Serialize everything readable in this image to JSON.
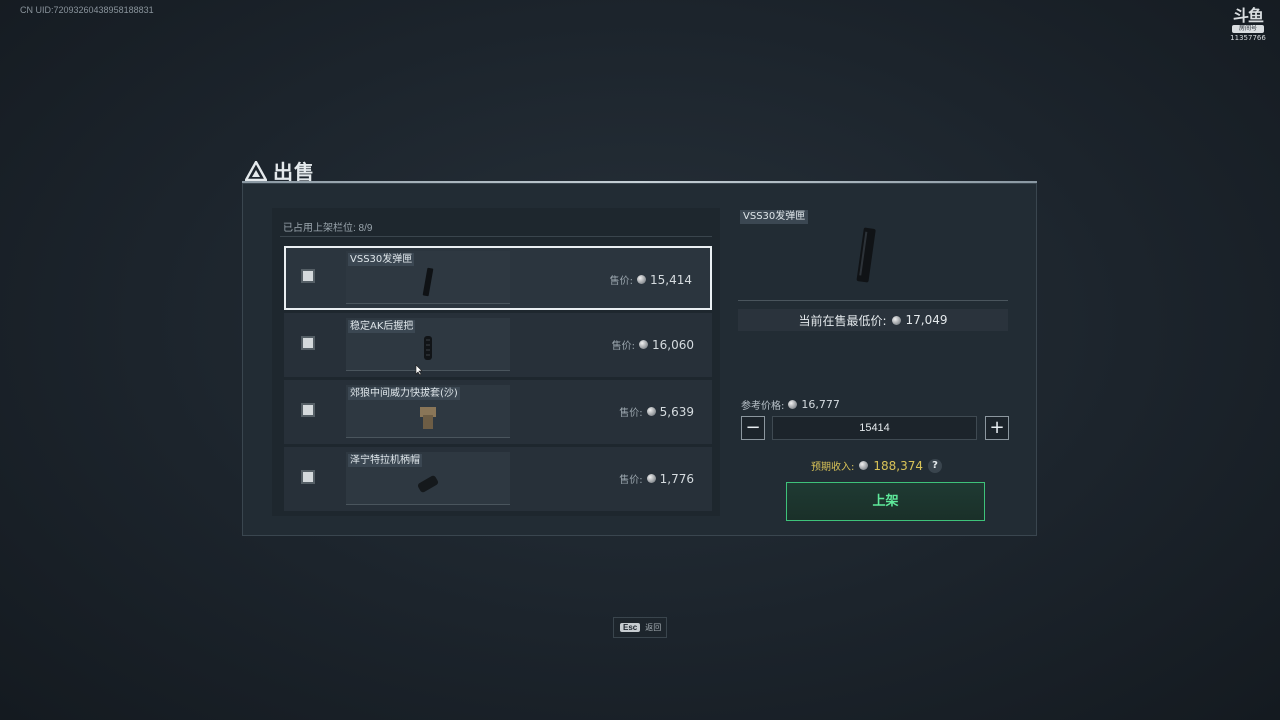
{
  "overlay": {
    "uid": "CN UID:72093260438958188831",
    "watermark_logo": "斗鱼",
    "watermark_tag": "房间号",
    "watermark_room": "11357766"
  },
  "dialog": {
    "title": "出售",
    "slots_label": "已占用上架栏位: 8/9",
    "items": [
      {
        "name": "VSS30发弹匣",
        "price_label": "售价:",
        "price": "15,414"
      },
      {
        "name": "稳定AK后握把",
        "price_label": "售价:",
        "price": "16,060"
      },
      {
        "name": "郊狼中间威力快拔套(沙)",
        "price_label": "售价:",
        "price": "5,639"
      },
      {
        "name": "泽宁特拉机柄帽",
        "price_label": "售价:",
        "price": "1,776"
      }
    ],
    "detail": {
      "name": "VSS30发弹匣",
      "lowest_label": "当前在售最低价:",
      "lowest_price": "17,049",
      "ref_label": "参考价格:",
      "ref_price": "16,777",
      "minus": "−",
      "plus": "+",
      "quantity": "15414",
      "income_label": "预期收入:",
      "income": "188,374",
      "help": "?",
      "list_button": "上架"
    },
    "footer": {
      "key": "Esc",
      "label": "返回"
    }
  }
}
